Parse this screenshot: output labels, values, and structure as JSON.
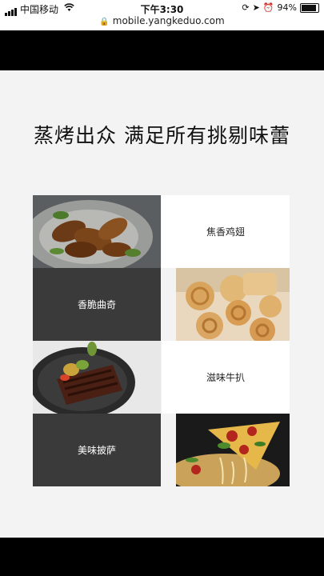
{
  "status_bar": {
    "carrier": "中国移动",
    "time": "下午3:30",
    "battery": "94%"
  },
  "url_bar": {
    "url": "mobile.yangkeduo.com"
  },
  "headline": "蒸烤出众 满足所有挑剔味蕾",
  "features": [
    {
      "label": "焦香鸡翅",
      "image": "roasted-chicken-wings-photo"
    },
    {
      "label": "香脆曲奇",
      "image": "butter-cookies-photo"
    },
    {
      "label": "滋味牛扒",
      "image": "grilled-steak-photo"
    },
    {
      "label": "美味披萨",
      "image": "pizza-slice-photo"
    }
  ],
  "icons": [
    "signal-icon",
    "wifi-icon",
    "lock-icon",
    "rotation-lock-icon",
    "location-icon",
    "alarm-icon",
    "battery-icon"
  ]
}
